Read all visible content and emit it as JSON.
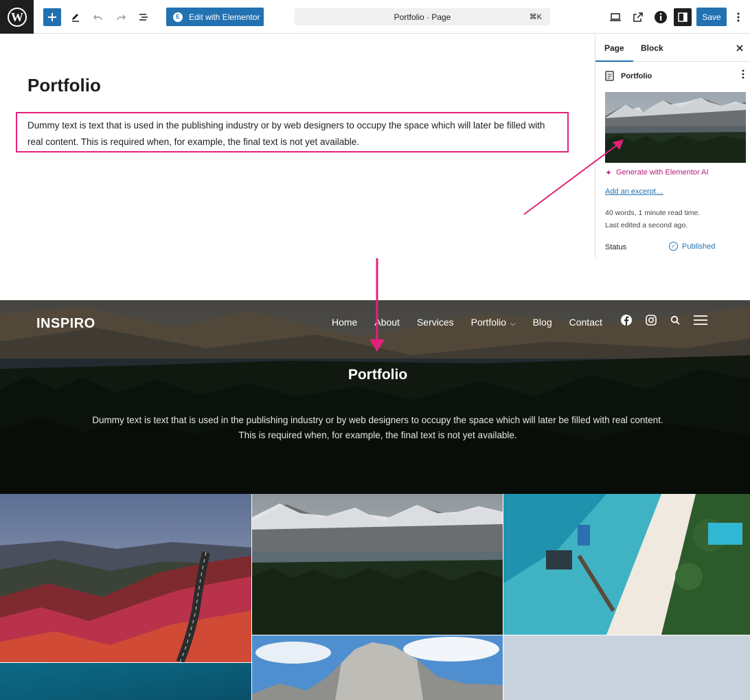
{
  "toolbar": {
    "edit_elementor_label": "Edit with Elementor",
    "command_bar_label": "Portfolio · Page",
    "command_shortcut": "⌘K",
    "save_label": "Save"
  },
  "editor": {
    "title": "Portfolio",
    "paragraph": "Dummy text is text that is used in the publishing industry or by web designers to occupy the space which will later be filled with real content. This is required when, for example, the final text is not yet available."
  },
  "sidebar": {
    "tab_page": "Page",
    "tab_block": "Block",
    "doc_title": "Portfolio",
    "ai_label": "Generate with Elementor AI",
    "excerpt_link": "Add an excerpt…",
    "word_count": "40 words, 1 minute read time.",
    "last_edited": "Last edited a second ago.",
    "status_label": "Status",
    "status_value": "Published"
  },
  "site": {
    "logo": "INSPIRO",
    "nav": [
      "Home",
      "About",
      "Services",
      "Portfolio",
      "Blog",
      "Contact"
    ],
    "hero_title": "Portfolio",
    "hero_text": "Dummy text is text that is used in the publishing industry or by web designers to occupy the space which will later be filled with real content. This is required when, for example, the final text is not yet available."
  },
  "colors": {
    "accent": "#2271b1",
    "annotation": "#e5207a",
    "ai": "#b61b7a"
  }
}
